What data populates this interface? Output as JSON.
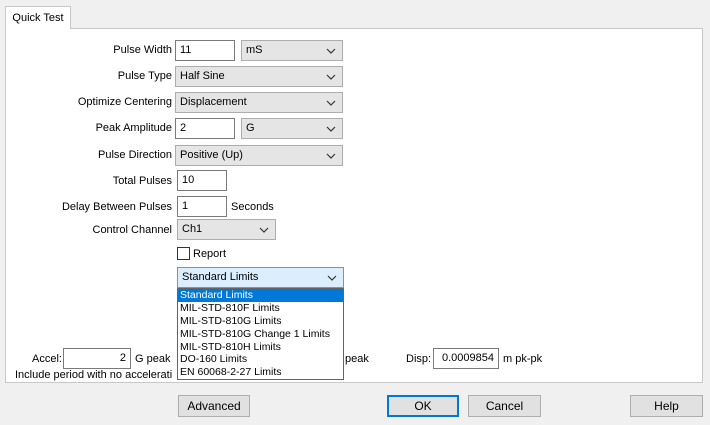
{
  "tab": {
    "label": "Quick Test"
  },
  "form": {
    "pulse_width": {
      "label": "Pulse Width",
      "value": "11",
      "unit": "mS"
    },
    "pulse_type": {
      "label": "Pulse Type",
      "value": "Half Sine"
    },
    "optimize_centering": {
      "label": "Optimize Centering",
      "value": "Displacement"
    },
    "peak_amplitude": {
      "label": "Peak Amplitude",
      "value": "2",
      "unit": "G"
    },
    "pulse_direction": {
      "label": "Pulse Direction",
      "value": "Positive (Up)"
    },
    "total_pulses": {
      "label": "Total Pulses",
      "value": "10"
    },
    "delay_between_pulses": {
      "label": "Delay Between Pulses",
      "value": "1",
      "unit": "Seconds"
    },
    "control_channel": {
      "label": "Control Channel",
      "value": "Ch1"
    },
    "report": {
      "label": "Report",
      "checked": false
    },
    "limits": {
      "value": "Standard Limits",
      "options": [
        "Standard Limits",
        "MIL-STD-810F Limits",
        "MIL-STD-810G Limits",
        "MIL-STD-810G Change 1 Limits",
        "MIL-STD-810H Limits",
        "DO-160 Limits",
        "EN 60068-2-27 Limits"
      ],
      "selected_index": 0
    }
  },
  "results": {
    "accel": {
      "label": "Accel:",
      "value": "2",
      "unit": "G peak"
    },
    "vel_unit_fragment": "peak",
    "disp": {
      "label": "Disp:",
      "value": "0.0009854",
      "unit": "m pk-pk"
    },
    "note_fragment": "Include period with no accelerati"
  },
  "buttons": {
    "advanced": "Advanced",
    "ok": "OK",
    "cancel": "Cancel",
    "help": "Help"
  },
  "colors": {
    "selection": "#0078d7",
    "focus_border": "#569de5"
  }
}
